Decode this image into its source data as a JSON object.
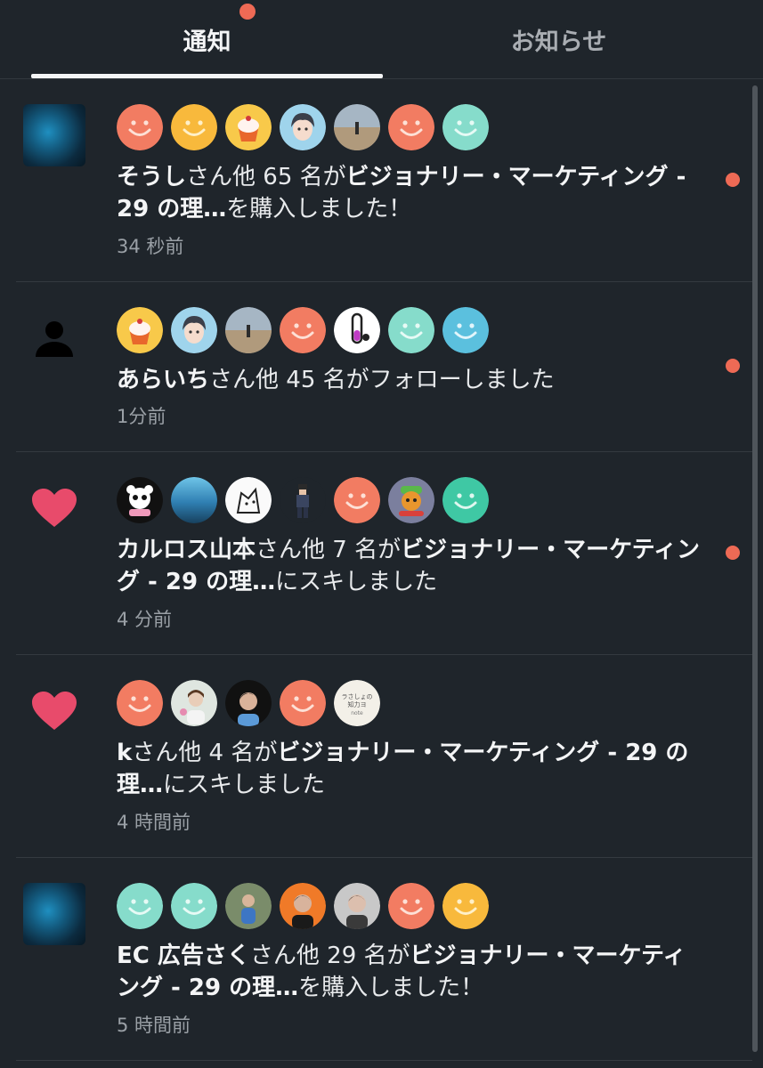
{
  "tabs": {
    "notifications": "通知",
    "news": "お知らせ"
  },
  "colors": {
    "background": "#1f252b",
    "unread_dot": "#ee6a55",
    "heart": "#e84b6b"
  },
  "notifications": [
    {
      "icon": "article-thumbnail",
      "avatars": [
        "smiley-coral",
        "smiley-yellow",
        "photo-cupcake",
        "photo-anime-boy",
        "photo-landscape",
        "smiley-coral",
        "smiley-mint"
      ],
      "name": "そうし",
      "mid": "さん他 65 名が",
      "target": "ビジョナリー・マーケティング - 29 の理…",
      "action": "を購入しました！",
      "time": "34 秒前",
      "unread": true
    },
    {
      "icon": "user-icon",
      "avatars": [
        "photo-cupcake",
        "photo-anime-boy",
        "photo-landscape",
        "smiley-coral",
        "photo-test-tube",
        "smiley-mint",
        "smiley-blue"
      ],
      "name": "あらいち",
      "mid": "さん他 45 名がフォローしました",
      "target": "",
      "action": "",
      "time": "1分前",
      "unread": true
    },
    {
      "icon": "heart-icon",
      "avatars": [
        "photo-panda",
        "photo-sea",
        "photo-dog-sketch",
        "photo-pixel-character",
        "smiley-coral",
        "photo-cartoon-dog",
        "smiley-green"
      ],
      "name": "カルロス山本",
      "mid": "さん他 7 名が",
      "target": "ビジョナリー・マーケティング - 29 の理…",
      "action": "にスキしました",
      "time": "4 分前",
      "unread": true
    },
    {
      "icon": "heart-icon",
      "avatars": [
        "smiley-coral",
        "photo-woman-flowers",
        "photo-man-dark",
        "smiley-coral",
        "photo-note-logo"
      ],
      "name": "k",
      "mid": "さん他 4 名が",
      "target": "ビジョナリー・マーケティング - 29 の理…",
      "action": "にスキしました",
      "time": "4 時間前",
      "unread": false
    },
    {
      "icon": "article-thumbnail",
      "avatars": [
        "smiley-mint",
        "smiley-mint",
        "photo-tennis",
        "photo-man-orange",
        "photo-man-gray",
        "smiley-coral",
        "smiley-yellow"
      ],
      "name": "EC 広告さく",
      "mid": "さん他 29 名が",
      "target": "ビジョナリー・マーケティング - 29 の理…",
      "action": "を購入しました！",
      "time": "5 時間前",
      "unread": false
    }
  ],
  "note_logo_text": "ラさしょの 知力ヨ note"
}
